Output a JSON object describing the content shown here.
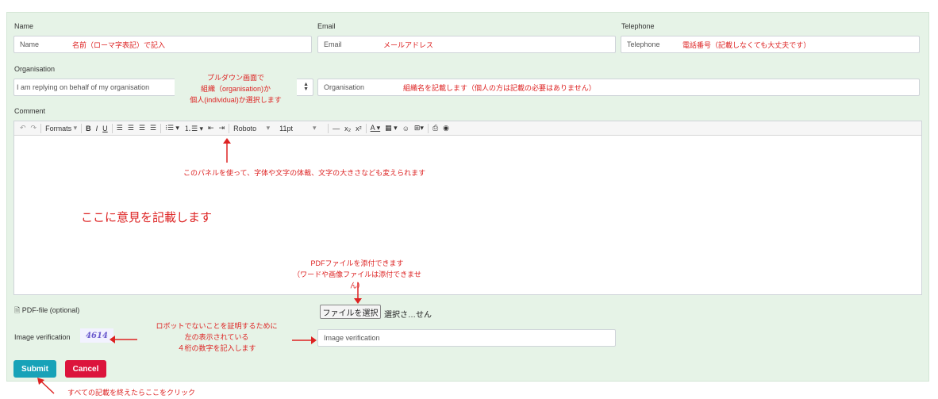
{
  "form": {
    "name_label": "Name",
    "name_placeholder": "Name",
    "name_note": "名前（ローマ字表記）で記入",
    "email_label": "Email",
    "email_placeholder": "Email",
    "email_note": "メールアドレス",
    "telephone_label": "Telephone",
    "telephone_placeholder": "Telephone",
    "telephone_note": "電話番号（記載しなくても大丈夫です）",
    "organisation_label": "Organisation",
    "organisation_select_value": "I am replying on behalf of my organisation",
    "organisation_placeholder": "Organisation",
    "organisation_note": "組織名を記載します（個人の方は記載の必要はありません）",
    "dropdown_tooltip": [
      "プルダウン画面で",
      "組織（organisation)か",
      "個人(individual)か選択します"
    ],
    "comment_label": "Comment",
    "toolbar": {
      "formats": "Formats",
      "font": "Roboto",
      "size": "11pt"
    },
    "toolbar_note": "このパネルを使って、字体や文字の体裁、文字の大きさなども変えられます",
    "comment_note": "ここに意見を記載します",
    "pdf_note": [
      "PDFファイルを添付できます",
      "（ワードや画像ファイルは添付できませ",
      "ん）"
    ],
    "pdf_label": "PDF-file (optional)",
    "file_button": "ファイルを選択",
    "file_status": "選択さ…せん",
    "image_label": "Image verification",
    "captcha": "4614",
    "captcha_note": [
      "ロボットでないことを証明するために",
      "左の表示されている",
      "４桁の数字を記入します"
    ],
    "image_placeholder": "Image verification",
    "submit": "Submit",
    "cancel": "Cancel",
    "submit_note": "すべての記載を終えたらここをクリック"
  },
  "colors": {
    "panel": "#e6f3e7",
    "submit": "#17a2b8",
    "cancel": "#dc143c",
    "note": "#dd2222"
  }
}
